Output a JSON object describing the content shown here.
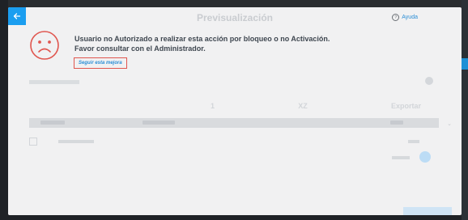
{
  "modal": {
    "title": "Previsualización",
    "help_label": "Ayuda",
    "back_icon": "arrow-left-icon"
  },
  "alert": {
    "icon": "sad-face-icon",
    "accent_color": "#e0564f",
    "message_line1": "Usuario no Autorizado a realizar esta acción por bloqueo o no Activación.",
    "message_line2": "Favor consultar con el Administrador.",
    "follow_link": "Seguir esta mejora"
  },
  "background": {
    "tabs": [
      "1",
      "XZ",
      "Exportar"
    ]
  },
  "colors": {
    "primary": "#1b9ef0",
    "link": "#2b8ed6",
    "text_dark": "#3f4750"
  }
}
